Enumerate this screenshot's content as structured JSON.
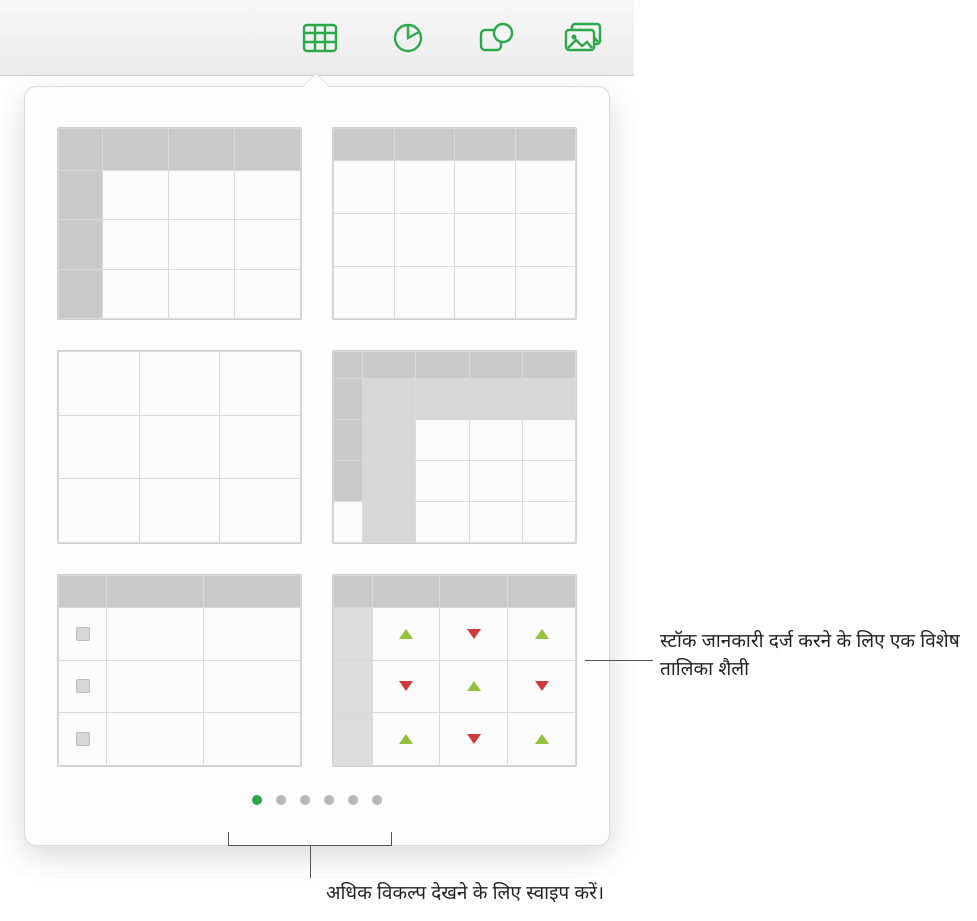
{
  "toolbar": {
    "icons": [
      "table-icon",
      "chart-icon",
      "shape-icon",
      "media-icon"
    ]
  },
  "popover": {
    "styles": [
      {
        "name": "table-style-header-row-col"
      },
      {
        "name": "table-style-header-row"
      },
      {
        "name": "table-style-plain"
      },
      {
        "name": "table-style-nested-header"
      },
      {
        "name": "table-style-checklist"
      },
      {
        "name": "table-style-stock"
      }
    ],
    "page_count": 6,
    "active_page": 0
  },
  "callouts": {
    "stock": "स्टॉक जानकारी दर्ज करने के लिए एक विशेष तालिका शैली",
    "swipe": "अधिक विकल्प देखने के लिए स्वाइप करें।"
  }
}
